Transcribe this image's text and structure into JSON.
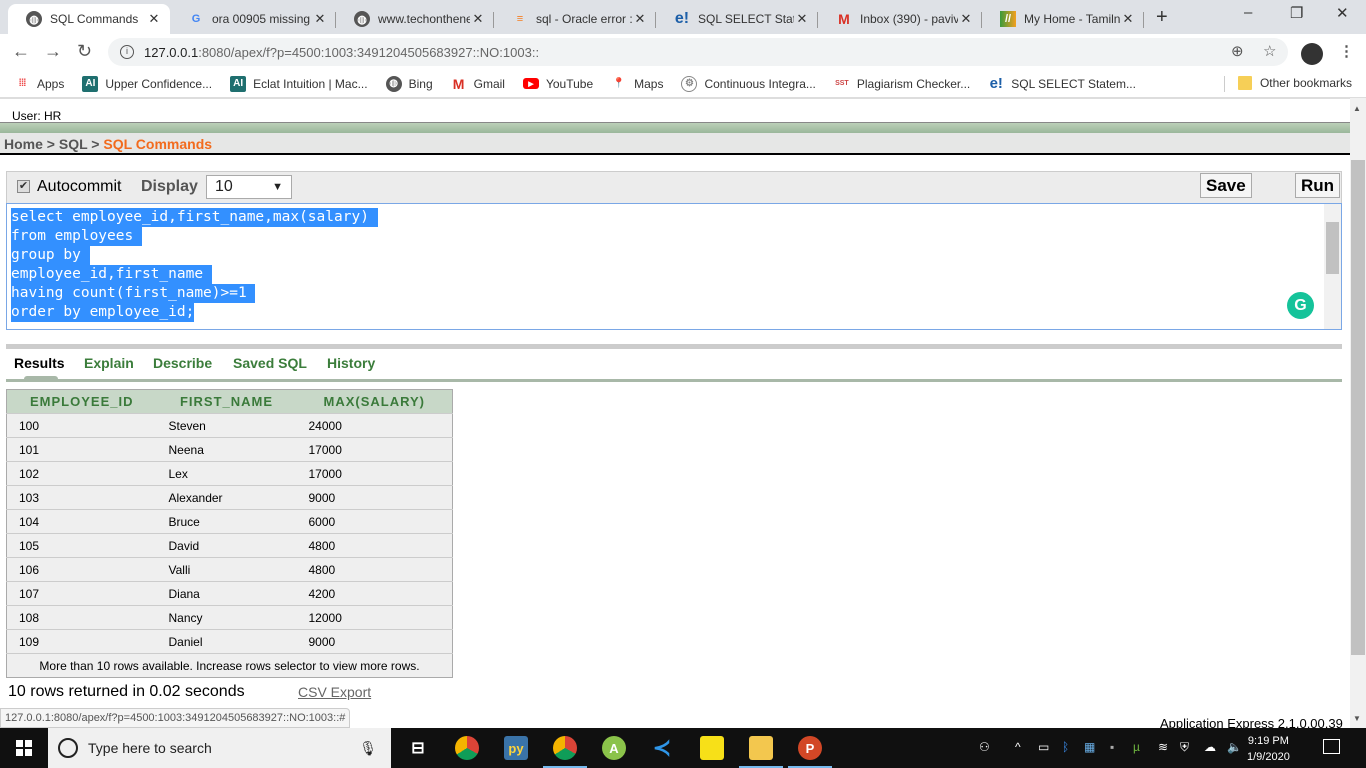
{
  "browser": {
    "tabs": [
      {
        "title": "SQL Commands",
        "icon": "globe-icon",
        "active": true
      },
      {
        "title": "ora 00905 missing",
        "icon": "google-icon",
        "active": false
      },
      {
        "title": "www.techonthenet",
        "icon": "globe-icon",
        "active": false
      },
      {
        "title": "sql - Oracle error :",
        "icon": "stackoverflow-icon",
        "active": false
      },
      {
        "title": "SQL SELECT Staten",
        "icon": "e-icon",
        "active": false
      },
      {
        "title": "Inbox (390) - paviv",
        "icon": "gmail-icon",
        "active": false
      },
      {
        "title": "My Home - Tamiln",
        "icon": "tamilnadu-icon",
        "active": false
      }
    ],
    "new_tab": "+",
    "window_controls": {
      "minimize": "–",
      "restore": "❐",
      "close": "✕"
    },
    "url": {
      "host": "127.0.0.1",
      "path": ":8080/apex/f?p=4500:1003:3491204505683927::NO:1003::"
    },
    "bookmarks": [
      {
        "label": "Apps",
        "icon": "apps-grid-icon"
      },
      {
        "label": "Upper Confidence...",
        "icon": "ai-icon"
      },
      {
        "label": "Eclat Intuition | Mac...",
        "icon": "ai-icon"
      },
      {
        "label": "Bing",
        "icon": "globe-icon"
      },
      {
        "label": "Gmail",
        "icon": "gmail-icon"
      },
      {
        "label": "YouTube",
        "icon": "youtube-icon"
      },
      {
        "label": "Maps",
        "icon": "maps-icon"
      },
      {
        "label": "Continuous Integra...",
        "icon": "jenkins-icon"
      },
      {
        "label": "Plagiarism Checker...",
        "icon": "sst-icon"
      },
      {
        "label": "SQL SELECT Statem...",
        "icon": "e-icon"
      }
    ],
    "other_bookmarks": "Other bookmarks"
  },
  "apex": {
    "user": "User: HR",
    "breadcrumb": {
      "home": "Home",
      "sep": " > ",
      "sql": "SQL",
      "current": "SQL Commands"
    },
    "autocommit_label": "Autocommit",
    "autocommit_checked": true,
    "display_label": "Display",
    "display_value": "10",
    "save_label": "Save",
    "run_label": "Run",
    "sql_lines": [
      "select employee_id,first_name,max(salary) ",
      "from employees ",
      "group by ",
      "employee_id,first_name ",
      "having count(first_name)>=1 ",
      "order by employee_id;"
    ],
    "result_tabs": [
      "Results",
      "Explain",
      "Describe",
      "Saved SQL",
      "History"
    ],
    "active_result_tab": "Results",
    "table": {
      "columns": [
        "EMPLOYEE_ID",
        "FIRST_NAME",
        "MAX(SALARY)"
      ],
      "rows": [
        [
          "100",
          "Steven",
          "24000"
        ],
        [
          "101",
          "Neena",
          "17000"
        ],
        [
          "102",
          "Lex",
          "17000"
        ],
        [
          "103",
          "Alexander",
          "9000"
        ],
        [
          "104",
          "Bruce",
          "6000"
        ],
        [
          "105",
          "David",
          "4800"
        ],
        [
          "106",
          "Valli",
          "4800"
        ],
        [
          "107",
          "Diana",
          "4200"
        ],
        [
          "108",
          "Nancy",
          "12000"
        ],
        [
          "109",
          "Daniel",
          "9000"
        ]
      ],
      "note": "More than 10 rows available. Increase rows selector to view more rows."
    },
    "rows_returned": "10 rows returned in 0.02 seconds",
    "csv_export": "CSV Export",
    "version": "Application Express 2.1.0.00.39",
    "status_url": "127.0.0.1:8080/apex/f?p=4500:1003:3491204505683927::NO:1003::#"
  },
  "taskbar": {
    "search_placeholder": "Type here to search",
    "time": "9:19 PM",
    "date": "1/9/2020"
  },
  "colors": {
    "breadcrumb_current": "#f26b1d",
    "tab_link": "#3b7d3b",
    "selection": "#3390ff"
  }
}
